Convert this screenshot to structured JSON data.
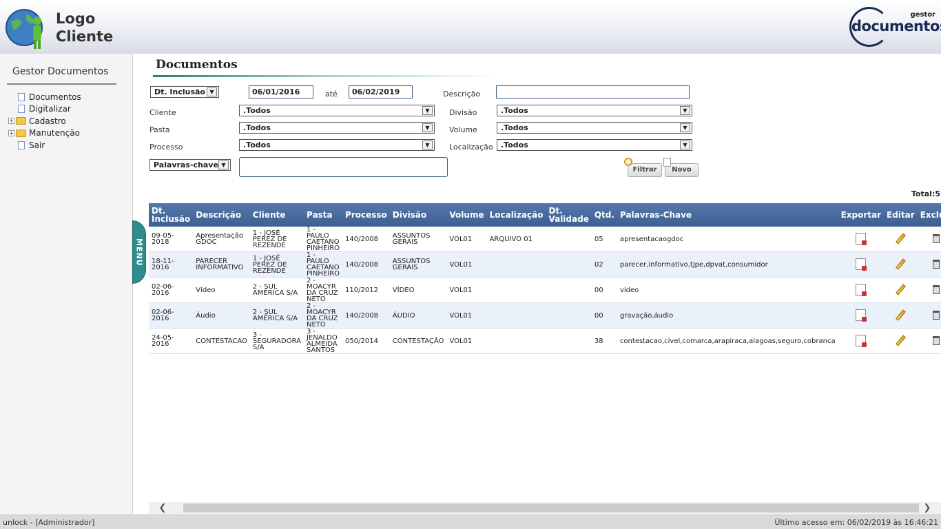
{
  "header": {
    "logo_line1": "Logo",
    "logo_line2": "Cliente",
    "brand_small": "gestor",
    "brand_big": "documentos"
  },
  "sidebar": {
    "title": "Gestor Documentos",
    "items": [
      {
        "label": "Documentos",
        "type": "doc"
      },
      {
        "label": "Digitalizar",
        "type": "doc"
      },
      {
        "label": "Cadastro",
        "type": "folder"
      },
      {
        "label": "Manutenção",
        "type": "folder"
      },
      {
        "label": "Sair",
        "type": "doc"
      }
    ]
  },
  "menu_tab": "MENU",
  "page": {
    "title": "Documentos"
  },
  "filters": {
    "date_field": "Dt. Inclusão",
    "date_from": "06/01/2016",
    "date_to_label": "até",
    "date_to": "06/02/2019",
    "descricao_label": "Descrição",
    "descricao_value": "",
    "cliente_label": "Cliente",
    "cliente_value": ".Todos",
    "divisao_label": "Divisão",
    "divisao_value": ".Todos",
    "pasta_label": "Pasta",
    "pasta_value": ".Todos",
    "volume_label": "Volume",
    "volume_value": ".Todos",
    "processo_label": "Processo",
    "processo_value": ".Todos",
    "localizacao_label": "Localização",
    "localizacao_value": ".Todos",
    "keyword_field": "Palavras-chave",
    "keyword_value": "",
    "filtrar_label": "Filtrar",
    "novo_label": "Novo"
  },
  "total": "Total:5",
  "table": {
    "columns": [
      "Dt. Inclusão",
      "Descrição",
      "Cliente",
      "Pasta",
      "Processo",
      "Divisão",
      "Volume",
      "Localização",
      "Dt. Validade",
      "Qtd.",
      "Palavras-Chave",
      "Exportar",
      "Editar",
      "Excluir"
    ],
    "rows": [
      {
        "dt": "09-05-2018",
        "descricao": "Apresentação GDOC",
        "cliente": "1 - JOSÉ PEREZ DE REZENDE",
        "pasta": "1 - PAULO CAETANO PINHEIRO",
        "processo": "140/2008",
        "divisao": "ASSUNTOS GERAIS",
        "volume": "VOL01",
        "localizacao": "ARQUIVO 01",
        "validade": "",
        "qtd": "05",
        "palavras": "apresentacaogdoc"
      },
      {
        "dt": "18-11-2016",
        "descricao": "PARECER INFORMATIVO",
        "cliente": "1 - JOSÉ PEREZ DE REZENDE",
        "pasta": "1 - PAULO CAETANO PINHEIRO",
        "processo": "140/2008",
        "divisao": "ASSUNTOS GERAIS",
        "volume": "VOL01",
        "localizacao": "",
        "validade": "",
        "qtd": "02",
        "palavras": "parecer,informativo,tjpe,dpvat,consumidor"
      },
      {
        "dt": "02-06-2016",
        "descricao": "Vídeo",
        "cliente": "2 - SUL AMÉRICA S/A",
        "pasta": "2 - MOACYR DA CRUZ NETO",
        "processo": "110/2012",
        "divisao": "VÍDEO",
        "volume": "VOL01",
        "localizacao": "",
        "validade": "",
        "qtd": "00",
        "palavras": "vídeo"
      },
      {
        "dt": "02-06-2016",
        "descricao": "Áudio",
        "cliente": "2 - SUL AMÉRICA S/A",
        "pasta": "2 - MOACYR DA CRUZ NETO",
        "processo": "140/2008",
        "divisao": "ÁUDIO",
        "volume": "VOL01",
        "localizacao": "",
        "validade": "",
        "qtd": "00",
        "palavras": "gravação,áudio"
      },
      {
        "dt": "24-05-2016",
        "descricao": "CONTESTACAO",
        "cliente": "3 - SEGURADORA S/A",
        "pasta": "3 - JENALDO ALMEIDA SANTOS",
        "processo": "050/2014",
        "divisao": "CONTESTAÇÃO",
        "volume": "VOL01",
        "localizacao": "",
        "validade": "",
        "qtd": "38",
        "palavras": "contestacao,civel,comarca,arapiraca,alagoas,seguro,cobranca"
      }
    ]
  },
  "statusbar": {
    "left": "unlock - [Administrador]",
    "right": "Último acesso em: 06/02/2019  às 16:46:21"
  }
}
